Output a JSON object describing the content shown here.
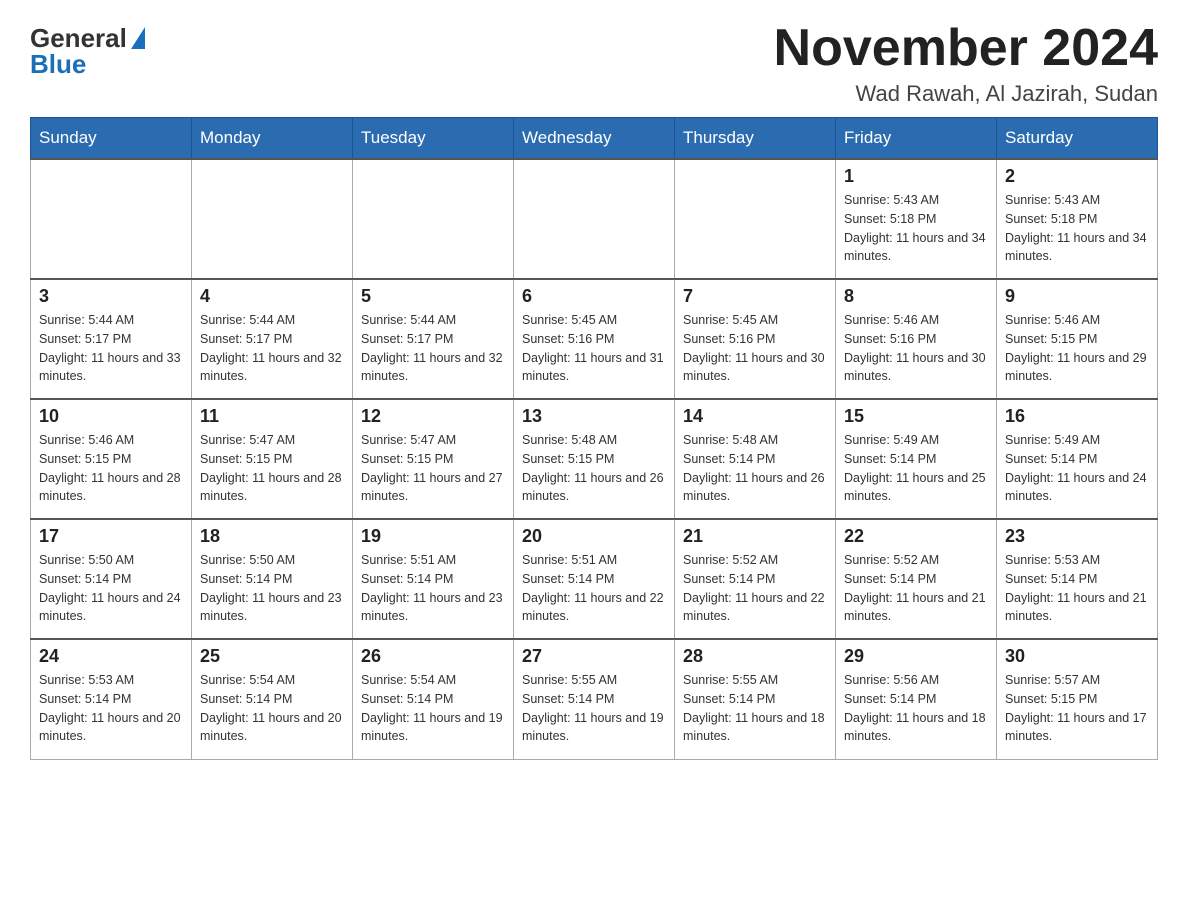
{
  "logo": {
    "general": "General",
    "blue": "Blue"
  },
  "title": "November 2024",
  "location": "Wad Rawah, Al Jazirah, Sudan",
  "days_of_week": [
    "Sunday",
    "Monday",
    "Tuesday",
    "Wednesday",
    "Thursday",
    "Friday",
    "Saturday"
  ],
  "weeks": [
    [
      {
        "day": "",
        "info": ""
      },
      {
        "day": "",
        "info": ""
      },
      {
        "day": "",
        "info": ""
      },
      {
        "day": "",
        "info": ""
      },
      {
        "day": "",
        "info": ""
      },
      {
        "day": "1",
        "info": "Sunrise: 5:43 AM\nSunset: 5:18 PM\nDaylight: 11 hours and 34 minutes."
      },
      {
        "day": "2",
        "info": "Sunrise: 5:43 AM\nSunset: 5:18 PM\nDaylight: 11 hours and 34 minutes."
      }
    ],
    [
      {
        "day": "3",
        "info": "Sunrise: 5:44 AM\nSunset: 5:17 PM\nDaylight: 11 hours and 33 minutes."
      },
      {
        "day": "4",
        "info": "Sunrise: 5:44 AM\nSunset: 5:17 PM\nDaylight: 11 hours and 32 minutes."
      },
      {
        "day": "5",
        "info": "Sunrise: 5:44 AM\nSunset: 5:17 PM\nDaylight: 11 hours and 32 minutes."
      },
      {
        "day": "6",
        "info": "Sunrise: 5:45 AM\nSunset: 5:16 PM\nDaylight: 11 hours and 31 minutes."
      },
      {
        "day": "7",
        "info": "Sunrise: 5:45 AM\nSunset: 5:16 PM\nDaylight: 11 hours and 30 minutes."
      },
      {
        "day": "8",
        "info": "Sunrise: 5:46 AM\nSunset: 5:16 PM\nDaylight: 11 hours and 30 minutes."
      },
      {
        "day": "9",
        "info": "Sunrise: 5:46 AM\nSunset: 5:15 PM\nDaylight: 11 hours and 29 minutes."
      }
    ],
    [
      {
        "day": "10",
        "info": "Sunrise: 5:46 AM\nSunset: 5:15 PM\nDaylight: 11 hours and 28 minutes."
      },
      {
        "day": "11",
        "info": "Sunrise: 5:47 AM\nSunset: 5:15 PM\nDaylight: 11 hours and 28 minutes."
      },
      {
        "day": "12",
        "info": "Sunrise: 5:47 AM\nSunset: 5:15 PM\nDaylight: 11 hours and 27 minutes."
      },
      {
        "day": "13",
        "info": "Sunrise: 5:48 AM\nSunset: 5:15 PM\nDaylight: 11 hours and 26 minutes."
      },
      {
        "day": "14",
        "info": "Sunrise: 5:48 AM\nSunset: 5:14 PM\nDaylight: 11 hours and 26 minutes."
      },
      {
        "day": "15",
        "info": "Sunrise: 5:49 AM\nSunset: 5:14 PM\nDaylight: 11 hours and 25 minutes."
      },
      {
        "day": "16",
        "info": "Sunrise: 5:49 AM\nSunset: 5:14 PM\nDaylight: 11 hours and 24 minutes."
      }
    ],
    [
      {
        "day": "17",
        "info": "Sunrise: 5:50 AM\nSunset: 5:14 PM\nDaylight: 11 hours and 24 minutes."
      },
      {
        "day": "18",
        "info": "Sunrise: 5:50 AM\nSunset: 5:14 PM\nDaylight: 11 hours and 23 minutes."
      },
      {
        "day": "19",
        "info": "Sunrise: 5:51 AM\nSunset: 5:14 PM\nDaylight: 11 hours and 23 minutes."
      },
      {
        "day": "20",
        "info": "Sunrise: 5:51 AM\nSunset: 5:14 PM\nDaylight: 11 hours and 22 minutes."
      },
      {
        "day": "21",
        "info": "Sunrise: 5:52 AM\nSunset: 5:14 PM\nDaylight: 11 hours and 22 minutes."
      },
      {
        "day": "22",
        "info": "Sunrise: 5:52 AM\nSunset: 5:14 PM\nDaylight: 11 hours and 21 minutes."
      },
      {
        "day": "23",
        "info": "Sunrise: 5:53 AM\nSunset: 5:14 PM\nDaylight: 11 hours and 21 minutes."
      }
    ],
    [
      {
        "day": "24",
        "info": "Sunrise: 5:53 AM\nSunset: 5:14 PM\nDaylight: 11 hours and 20 minutes."
      },
      {
        "day": "25",
        "info": "Sunrise: 5:54 AM\nSunset: 5:14 PM\nDaylight: 11 hours and 20 minutes."
      },
      {
        "day": "26",
        "info": "Sunrise: 5:54 AM\nSunset: 5:14 PM\nDaylight: 11 hours and 19 minutes."
      },
      {
        "day": "27",
        "info": "Sunrise: 5:55 AM\nSunset: 5:14 PM\nDaylight: 11 hours and 19 minutes."
      },
      {
        "day": "28",
        "info": "Sunrise: 5:55 AM\nSunset: 5:14 PM\nDaylight: 11 hours and 18 minutes."
      },
      {
        "day": "29",
        "info": "Sunrise: 5:56 AM\nSunset: 5:14 PM\nDaylight: 11 hours and 18 minutes."
      },
      {
        "day": "30",
        "info": "Sunrise: 5:57 AM\nSunset: 5:15 PM\nDaylight: 11 hours and 17 minutes."
      }
    ]
  ]
}
